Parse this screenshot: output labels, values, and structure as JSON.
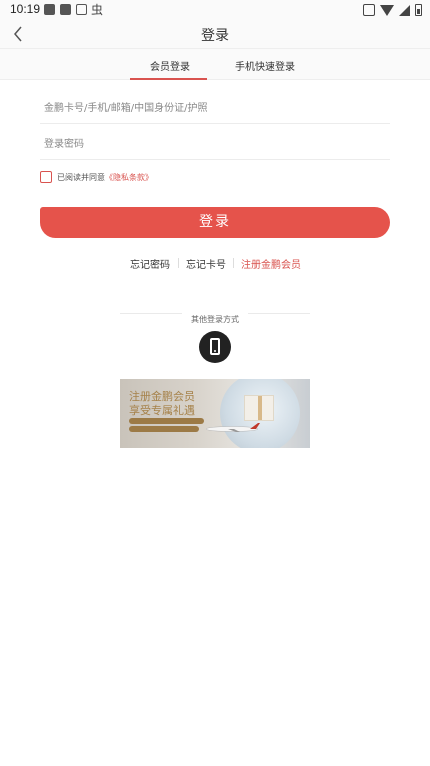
{
  "status_bar": {
    "time": "10:19",
    "glyph": "虫"
  },
  "nav": {
    "title": "登录"
  },
  "tabs": [
    {
      "label": "会员登录"
    },
    {
      "label": "手机快速登录"
    }
  ],
  "form": {
    "account_placeholder": "金鹏卡号/手机/邮箱/中国身份证/护照",
    "password_placeholder": "登录密码",
    "agree_text": "已阅读并同意",
    "privacy_link": "《隐私条款》",
    "login_button": "登录"
  },
  "links": {
    "forgot_password": "忘记密码",
    "forgot_card": "忘记卡号",
    "register": "注册金鹏会员"
  },
  "other_login": {
    "title": "其他登录方式"
  },
  "banner": {
    "headline1": "注册金鹏会员",
    "headline2": "享受专属礼遇"
  },
  "colors": {
    "accent": "#e5534b"
  }
}
